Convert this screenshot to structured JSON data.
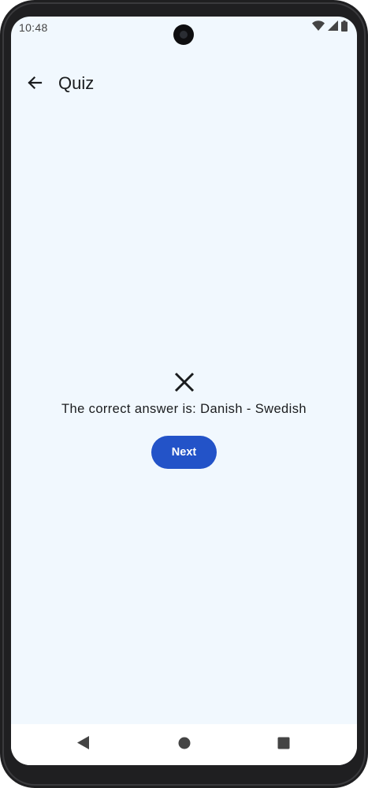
{
  "status_bar": {
    "time": "10:48",
    "icons": [
      "wifi-icon",
      "signal-icon",
      "battery-icon"
    ]
  },
  "app_bar": {
    "back_icon": "arrow-back-icon",
    "title": "Quiz"
  },
  "result": {
    "icon": "close-icon",
    "answer_text": "The correct answer is: Danish - Swedish",
    "next_label": "Next"
  },
  "nav_bar": {
    "items": [
      "back-triangle-icon",
      "home-circle-icon",
      "recents-square-icon"
    ]
  },
  "colors": {
    "screen_bg": "#f1f8fe",
    "accent": "#2353c8",
    "text": "#1a1c1e"
  }
}
